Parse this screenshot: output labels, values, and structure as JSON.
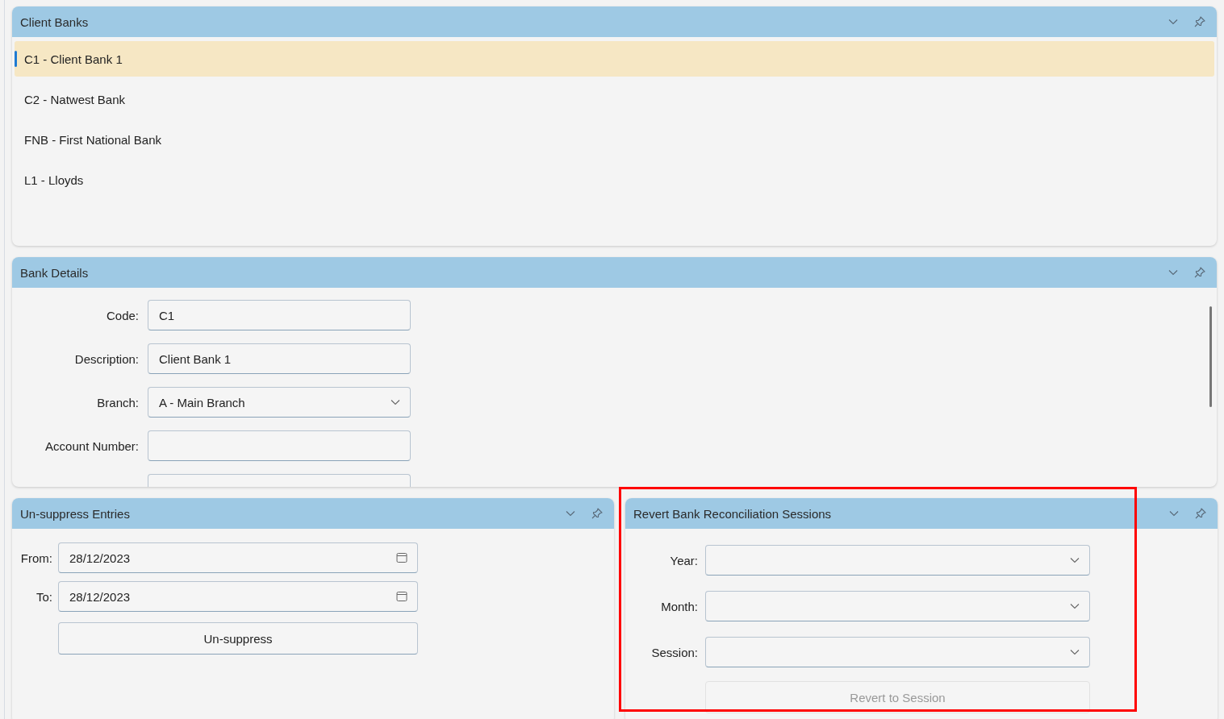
{
  "client_banks": {
    "title": "Client Banks",
    "items": [
      {
        "label": "C1 - Client Bank 1",
        "selected": true
      },
      {
        "label": "C2 - Natwest Bank",
        "selected": false
      },
      {
        "label": "FNB - First National Bank",
        "selected": false
      },
      {
        "label": "L1 - Lloyds",
        "selected": false
      }
    ]
  },
  "bank_details": {
    "title": "Bank Details",
    "fields": [
      {
        "label": "Code:",
        "value": "C1",
        "kind": "text"
      },
      {
        "label": "Description:",
        "value": "Client Bank 1",
        "kind": "text"
      },
      {
        "label": "Branch:",
        "value": "A - Main Branch",
        "kind": "select"
      },
      {
        "label": "Account Number:",
        "kind": "text"
      }
    ]
  },
  "unsuppress": {
    "title": "Un-suppress Entries",
    "fields": [
      {
        "label": "From:",
        "value": "28/12/2023"
      },
      {
        "label": "To:",
        "value": "28/12/2023"
      }
    ],
    "button": {
      "label": "Un-suppress",
      "disabled": false
    }
  },
  "revert": {
    "title": "Revert Bank Reconciliation Sessions",
    "fields": [
      {
        "label": "Year:"
      },
      {
        "label": "Month:"
      },
      {
        "label": "Session:"
      }
    ],
    "button": {
      "label": "Revert to Session",
      "disabled": true
    }
  }
}
